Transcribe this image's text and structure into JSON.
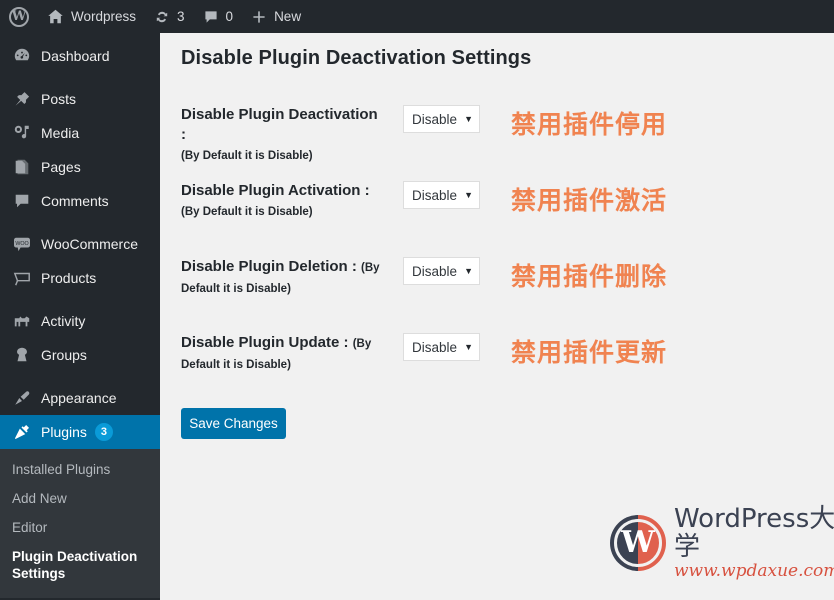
{
  "adminbar": {
    "logo_icon": "wordpress-logo-icon",
    "site": {
      "icon": "home-icon",
      "label": "Wordpress"
    },
    "updates": {
      "icon": "updates-icon",
      "count": "3"
    },
    "comments": {
      "icon": "comment-bubble-icon",
      "count": "0"
    },
    "new": {
      "icon": "plus-icon",
      "label": "New"
    }
  },
  "sidebar": {
    "items": [
      {
        "label": "Dashboard",
        "icon": "dashboard-icon"
      },
      {
        "label": "Posts",
        "icon": "pin-icon"
      },
      {
        "label": "Media",
        "icon": "media-icon"
      },
      {
        "label": "Pages",
        "icon": "page-icon"
      },
      {
        "label": "Comments",
        "icon": "comment-bubble-icon"
      },
      {
        "label": "WooCommerce",
        "icon": "woo-icon"
      },
      {
        "label": "Products",
        "icon": "cart-icon"
      },
      {
        "label": "Activity",
        "icon": "activity-icon"
      },
      {
        "label": "Groups",
        "icon": "groups-icon"
      },
      {
        "label": "Appearance",
        "icon": "paintbrush-icon"
      },
      {
        "label": "Plugins",
        "icon": "plug-icon",
        "badge": "3",
        "current": true
      }
    ],
    "submenu": [
      {
        "label": "Installed Plugins"
      },
      {
        "label": "Add New"
      },
      {
        "label": "Editor"
      },
      {
        "label": "Plugin Deactivation Settings",
        "current": true
      }
    ]
  },
  "main": {
    "title": "Disable Plugin Deactivation Settings",
    "note": "(By Default it is Disable)",
    "rows": [
      {
        "label": "Disable Plugin Deactivation :",
        "note": "(By Default it is Disable)",
        "select_value": "Disable",
        "select_arrow": "▼",
        "annotation": "禁用插件停用"
      },
      {
        "label": "Disable Plugin Activation :",
        "note": "(By Default it is Disable)",
        "select_value": "Disable",
        "select_arrow": "▼",
        "annotation": "禁用插件激活"
      },
      {
        "label": "Disable Plugin Deletion :",
        "note": "(By Default it is Disable)",
        "select_value": "Disable",
        "select_arrow": "▼",
        "annotation": "禁用插件删除"
      },
      {
        "label": "Disable Plugin Update :",
        "note": "(By Default it is Disable)",
        "select_value": "Disable",
        "select_arrow": "▼",
        "annotation": "禁用插件更新"
      }
    ],
    "save_label": "Save Changes"
  },
  "watermark": {
    "logo_letter": "W",
    "title": "WordPress大学",
    "url": "www.wpdaxue.com"
  },
  "colors": {
    "admin_blue": "#0073aa",
    "admin_dark": "#23282d",
    "submenu_dark": "#32373c",
    "content_bg": "#f1f1f1",
    "annotation_orange": "#f08350",
    "watermark_red": "#d7513f"
  }
}
